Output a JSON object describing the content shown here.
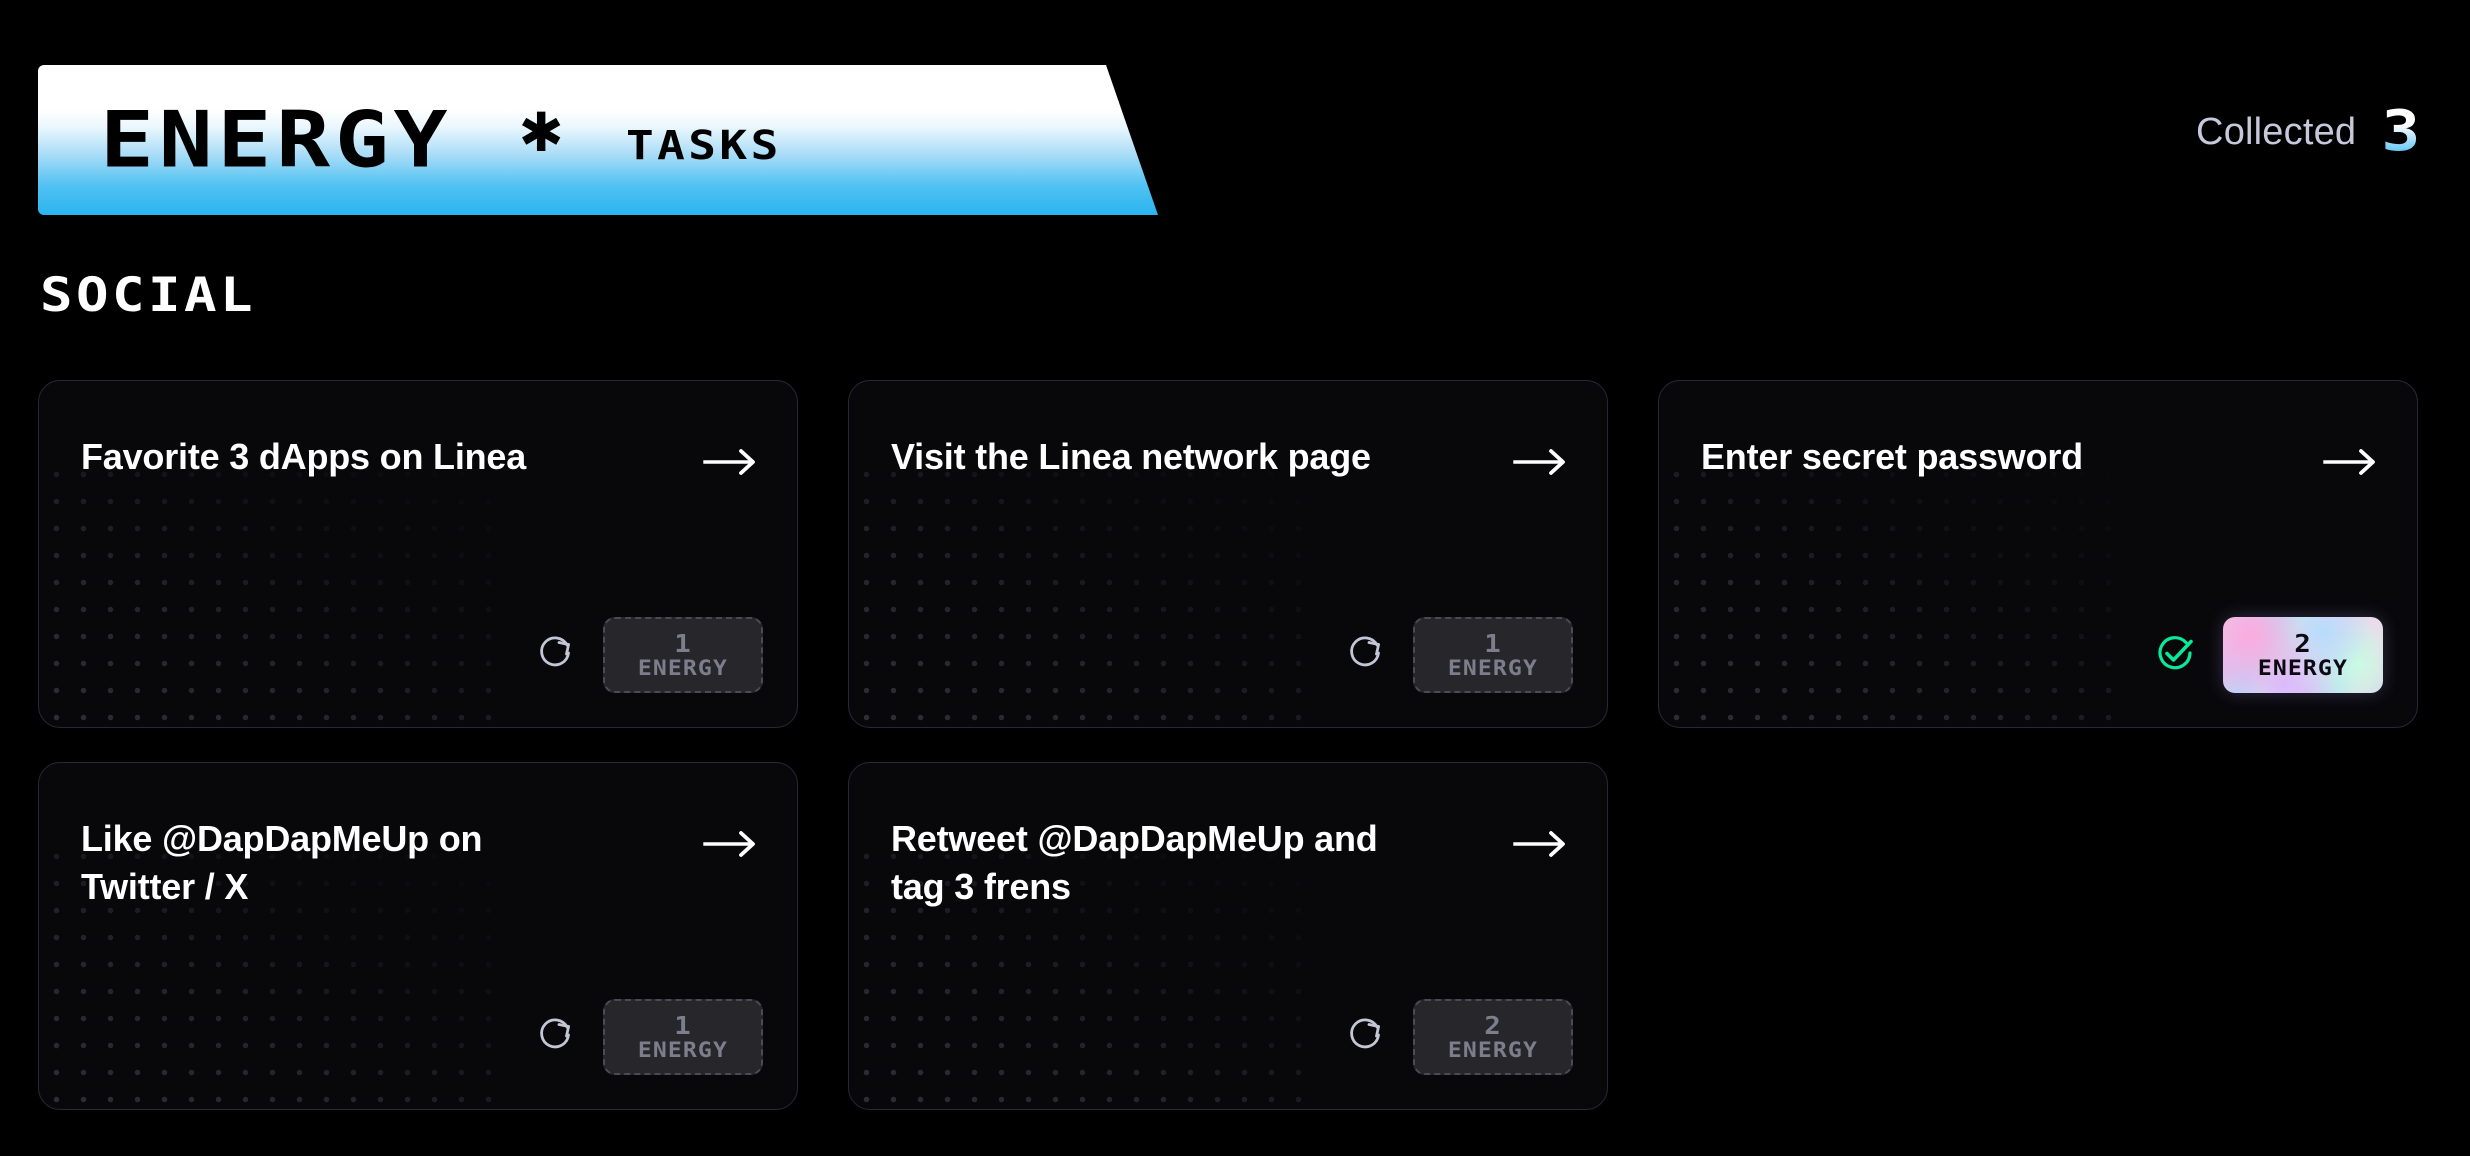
{
  "header": {
    "logo_energy": "ENERGY",
    "logo_star": "✱",
    "logo_tasks": "TASKS",
    "collected_label": "Collected",
    "collected_count": "3",
    "accent_blue": "#2ab4ef",
    "accent_green": "#0ae89a"
  },
  "sections": [
    {
      "title": "SOCIAL",
      "cards": [
        {
          "title": "Favorite 3 dApps on Linea",
          "arrow_icon": "arrow-right-icon",
          "refresh_icon": "refresh-icon",
          "has_refresh": true,
          "completed": false,
          "energy_value": "1",
          "energy_label": "ENERGY"
        },
        {
          "title": "Visit the Linea network page",
          "arrow_icon": "arrow-right-icon",
          "refresh_icon": "refresh-icon",
          "has_refresh": true,
          "completed": false,
          "energy_value": "1",
          "energy_label": "ENERGY"
        },
        {
          "title": "Enter secret password",
          "arrow_icon": "arrow-right-icon",
          "check_icon": "check-circle-icon",
          "has_refresh": false,
          "completed": true,
          "energy_value": "2",
          "energy_label": "ENERGY"
        },
        {
          "title": "Like @DapDapMeUp on Twitter / X",
          "arrow_icon": "arrow-right-icon",
          "refresh_icon": "refresh-icon",
          "has_refresh": true,
          "completed": false,
          "energy_value": "1",
          "energy_label": "ENERGY"
        },
        {
          "title": "Retweet @DapDapMeUp and tag 3 frens",
          "arrow_icon": "arrow-right-icon",
          "refresh_icon": "refresh-icon",
          "has_refresh": true,
          "completed": false,
          "energy_value": "2",
          "energy_label": "ENERGY"
        }
      ]
    }
  ]
}
